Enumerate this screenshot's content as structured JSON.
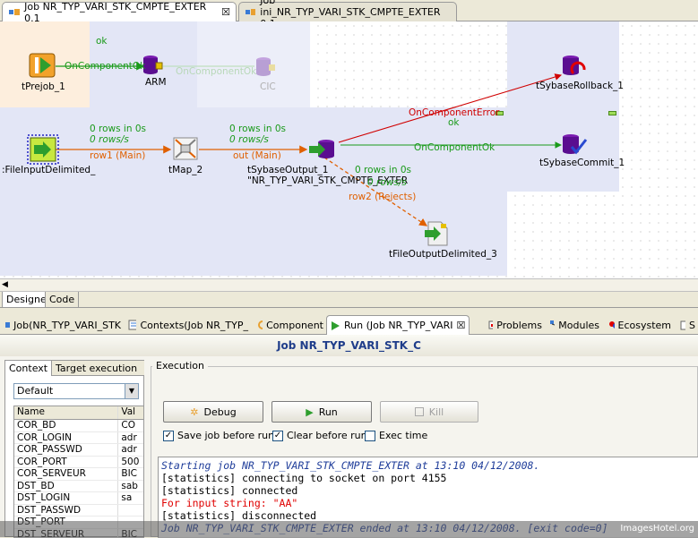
{
  "editor_tabs": [
    {
      "label": "Job NR_TYP_VARI_STK_CMPTE_EXTER 0.1",
      "active": true
    },
    {
      "label": "Job ini_NR_TYP_VARI_STK_CMPTE_EXTER 0.1",
      "active": false
    }
  ],
  "canvas": {
    "components": {
      "prejob": "tPrejob_1",
      "arm": "ARM",
      "cic": "CIC",
      "file_input": ":FileInputDelimited_",
      "tmap": "tMap_2",
      "sybase_output": "tSybaseOutput_1",
      "sybase_output_table": "\"NR_TYP_VARI_STK_CMPTE_EXTER",
      "sybase_rollback": "tSybaseRollback_1",
      "sybase_commit": "tSybaseCommit_1",
      "file_output": "tFileOutputDelimited_3"
    },
    "links": {
      "ok_top": "ok",
      "oncomponentok_1": "OnComponentOk",
      "oncomponentok_2": "OnComponentOk",
      "row1_rows": "0 rows in 0s",
      "row1_rate": "0 rows/s",
      "row1_name": "row1 (Main)",
      "out_rows": "0 rows in 0s",
      "out_rate": "0 rows/s",
      "out_name": "out (Main)",
      "oncomponenterror": "OnComponentError",
      "ok_mid": "ok",
      "oncomponentok_3": "OnComponentOk",
      "reject_rows": "0 rows in 0s",
      "reject_rate": "0 rows/s",
      "reject_name": "row2 (Rejects)"
    }
  },
  "designer_tabs": {
    "designer": "Designer",
    "code": "Code"
  },
  "view_tabs": [
    {
      "label": "Job(NR_TYP_VARI_STK",
      "icon": "job-icon"
    },
    {
      "label": "Contexts(Job NR_TYP_",
      "icon": "contexts-icon"
    },
    {
      "label": "Component",
      "icon": "component-icon"
    },
    {
      "label": "Run (Job NR_TYP_VARI",
      "icon": "run-icon",
      "active": true
    },
    {
      "label": "Problems",
      "icon": "problems-icon"
    },
    {
      "label": "Modules",
      "icon": "modules-icon"
    },
    {
      "label": "Ecosystem",
      "icon": "ecosystem-icon"
    },
    {
      "label": "S",
      "icon": "scheduler-icon"
    }
  ],
  "run": {
    "title": "Job NR_TYP_VARI_STK_C",
    "context_tab": "Context",
    "target_tab": "Target execution",
    "context_selected": "Default",
    "table_headers": [
      "Name",
      "Val"
    ],
    "table_rows": [
      [
        "COR_BD",
        "CO"
      ],
      [
        "COR_LOGIN",
        "adr"
      ],
      [
        "COR_PASSWD",
        "adr"
      ],
      [
        "COR_PORT",
        "500"
      ],
      [
        "COR_SERVEUR",
        "BIC"
      ],
      [
        "DST_BD",
        "sab"
      ],
      [
        "DST_LOGIN",
        "sa"
      ],
      [
        "DST_PASSWD",
        ""
      ],
      [
        "DST_PORT",
        ""
      ],
      [
        "DST_SERVEUR",
        "BIC"
      ]
    ],
    "execution_label": "Execution",
    "debug_label": "Debug",
    "run_label": "Run",
    "kill_label": "Kill",
    "save_job_label": "Save job before run",
    "clear_label": "Clear before run",
    "exec_time_label": "Exec time",
    "console_lines": [
      {
        "text": "Starting job NR_TYP_VARI_STK_CMPTE_EXTER at 13:10 04/12/2008.",
        "cls": "ln-blue"
      },
      {
        "text": "[statistics] connecting to socket on port 4155",
        "cls": "ln-black"
      },
      {
        "text": "[statistics] connected",
        "cls": "ln-black"
      },
      {
        "text": "For input string: \"AA\"",
        "cls": "ln-red"
      },
      {
        "text": "[statistics] disconnected",
        "cls": "ln-black"
      },
      {
        "text": "Job NR_TYP_VARI_STK_CMPTE_EXTER ended at 13:10 04/12/2008. [exit code=0]",
        "cls": "ln-blue"
      }
    ]
  },
  "watermark": "ImagesHotel.org"
}
